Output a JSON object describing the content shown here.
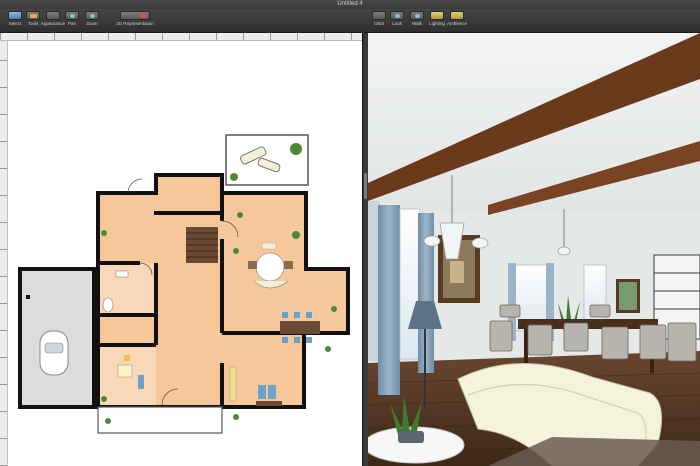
{
  "window": {
    "title": "Untitled 4"
  },
  "toolbar_left": [
    {
      "id": "select",
      "label": "Select",
      "icon": "cursor-icon"
    },
    {
      "id": "tools",
      "label": "Tools",
      "icon": "toolbox-icon"
    },
    {
      "id": "appearance",
      "label": "Appearance",
      "icon": "palette-icon"
    },
    {
      "id": "pan",
      "label": "Pan",
      "icon": "hand-icon"
    },
    {
      "id": "zoom",
      "label": "Zoom",
      "icon": "magnifier-icon"
    },
    {
      "id": "2d3d",
      "label": "2D Representation",
      "icon": "view-toggle-icon"
    }
  ],
  "toolbar_right": [
    {
      "id": "orbit",
      "label": "Orbit",
      "icon": "orbit-icon"
    },
    {
      "id": "look",
      "label": "Look",
      "icon": "eye-icon"
    },
    {
      "id": "walk",
      "label": "Walk",
      "icon": "walk-icon"
    },
    {
      "id": "lighting",
      "label": "Lighting",
      "icon": "bulb-icon"
    },
    {
      "id": "ambience",
      "label": "Ambience",
      "icon": "sun-icon"
    }
  ],
  "colors": {
    "floor": "#f5c79a",
    "wall": "#111111",
    "garage_floor": "#dcdcdc",
    "toolbar": "#3a3a3a",
    "ceiling_beam": "#6b3a1c",
    "wood_floor": "#5a3a26",
    "wall_3d": "#e4e8e6"
  }
}
